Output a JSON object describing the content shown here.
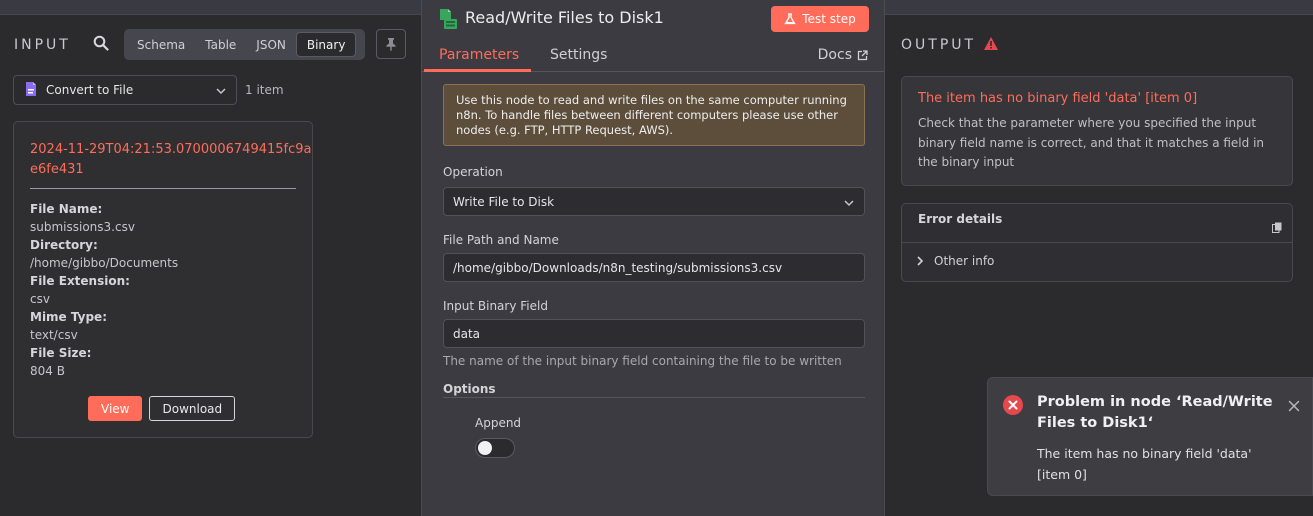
{
  "input": {
    "title": "INPUT",
    "view_tabs": [
      "Schema",
      "Table",
      "JSON",
      "Binary"
    ],
    "active_tab": "Binary",
    "node_select": "Convert to File",
    "item_count": "1 item",
    "binary": {
      "title": "2024-11-29T04:21:53.0700006749415fc9aae6fe431",
      "fields": [
        {
          "key": "File Name:",
          "value": "submissions3.csv"
        },
        {
          "key": "Directory:",
          "value": "/home/gibbo/Documents"
        },
        {
          "key": "File Extension:",
          "value": "csv"
        },
        {
          "key": "Mime Type:",
          "value": "text/csv"
        },
        {
          "key": "File Size:",
          "value": "804 B"
        }
      ],
      "view_label": "View",
      "download_label": "Download"
    }
  },
  "node": {
    "title": "Read/Write Files to Disk1",
    "test_step_label": "Test step",
    "tabs": [
      "Parameters",
      "Settings"
    ],
    "docs_label": "Docs",
    "notice": "Use this node to read and write files on the same computer running n8n. To handle files between different computers please use other nodes (e.g. FTP, HTTP Request, AWS).",
    "operation_label": "Operation",
    "operation_value": "Write File to Disk",
    "file_path_label": "File Path and Name",
    "file_path_value": "/home/gibbo/Downloads/n8n_testing/submissions3.csv",
    "binary_field_label": "Input Binary Field",
    "binary_field_value": "data",
    "binary_field_hint": "The name of the input binary field containing the file to be written",
    "options_label": "Options",
    "append_label": "Append"
  },
  "output": {
    "title": "OUTPUT",
    "error_title": "The item has no binary field 'data' [item 0]",
    "error_body": "Check that the parameter where you specified the input binary field name is correct, and that it matches a field in the binary input",
    "details_label": "Error details",
    "other_info_label": "Other info"
  },
  "toast": {
    "title": "Problem in node ‘Read/Write Files to Disk1‘",
    "body": "The item has no binary field 'data' [item 0]"
  },
  "colors": {
    "accent": "#ff6d5a",
    "background": "#2b2b2d",
    "panel": "#3b3b41",
    "notice_bg": "#5c4e3b",
    "error_icon": "#e5484d"
  }
}
